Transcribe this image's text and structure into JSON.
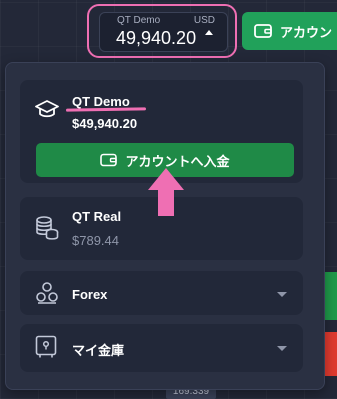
{
  "header": {
    "account_selector": {
      "mode_label": "QT Demo",
      "currency": "USD",
      "balance": "49,940.20"
    },
    "topup_button_label": "アカウン"
  },
  "dropdown": {
    "demo_account": {
      "title": "QT Demo",
      "balance": "$49,940.20",
      "deposit_button_label": "アカウントへ入金",
      "icon": "graduation-cap-icon"
    },
    "real_account": {
      "title": "QT Real",
      "balance": "$789.44",
      "icon": "coins-stack-icon"
    },
    "forex": {
      "label": "Forex",
      "icon": "forex-icon"
    },
    "safe": {
      "label": "マイ金庫",
      "icon": "safe-icon"
    }
  },
  "chart": {
    "price_label": "169.339"
  },
  "colors": {
    "accent_green": "#21a15a",
    "annotation_pink": "#ef6fb3",
    "panel_bg": "#2a3042",
    "card_bg": "#222839"
  }
}
